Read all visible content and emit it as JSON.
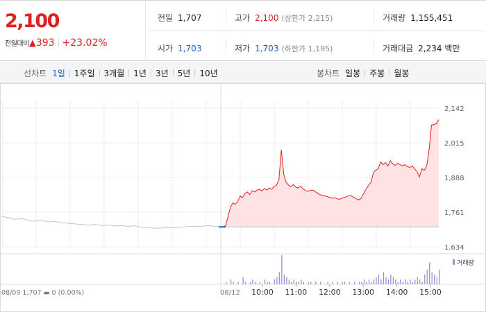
{
  "quote": {
    "price": "2,100",
    "change_label": "전일대비",
    "change_arrow": "▲",
    "change_value": "393",
    "change_rate": "+23.02%"
  },
  "info": {
    "prev_close": {
      "label": "전일",
      "value": "1,707"
    },
    "high": {
      "label": "고가",
      "value": "2,100",
      "sub": "(상한가 2,215)"
    },
    "volume": {
      "label": "거래량",
      "value": "1,155,451"
    },
    "open": {
      "label": "시가",
      "value": "1,703"
    },
    "low": {
      "label": "저가",
      "value": "1,703",
      "sub": "(하한가 1,195)"
    },
    "amount": {
      "label": "거래대금",
      "value": "2,234 백만"
    }
  },
  "tabs": {
    "line_title": "선차트",
    "line_periods": [
      "1일",
      "1주일",
      "3개월",
      "1년",
      "3년",
      "5년",
      "10년"
    ],
    "line_active": 0,
    "candle_title": "봉차트",
    "candle_periods": [
      "일봉",
      "주봉",
      "월봉"
    ]
  },
  "colors": {
    "up": "#e1201f",
    "down": "#1a5dd0",
    "area_fill": "#fde3e3",
    "prev_line": "#c0c4c8",
    "volume_bar": "#9b8fd6"
  },
  "chart_data": {
    "type": "area",
    "ylim": [
      1634,
      2142
    ],
    "y_ticks": [
      "2,142",
      "2,015",
      "1,888",
      "1,761",
      "1,634"
    ],
    "y_tick_values": [
      2142,
      2015,
      1888,
      1761,
      1634
    ],
    "prev_close_value": 1707,
    "prev_day": {
      "label": "08/09",
      "summary": "08/09  1,707 ▬ 0 (0.00%)",
      "values": [
        1745,
        1740,
        1735,
        1738,
        1730,
        1728,
        1732,
        1725,
        1727,
        1722,
        1720,
        1718,
        1716,
        1714,
        1716,
        1712,
        1714,
        1710,
        1712,
        1709,
        1711,
        1706,
        1704,
        1702,
        1703,
        1705,
        1704,
        1706,
        1708,
        1710,
        1708,
        1712,
        1710,
        1707
      ]
    },
    "today": {
      "label": "08/12",
      "x_ticks": [
        "10:00",
        "11:00",
        "12:00",
        "13:00",
        "14:00",
        "15:00"
      ],
      "values": [
        1707,
        1707,
        1712,
        1745,
        1780,
        1795,
        1790,
        1800,
        1820,
        1815,
        1830,
        1835,
        1825,
        1840,
        1835,
        1842,
        1845,
        1838,
        1848,
        1842,
        1850,
        1845,
        1855,
        1860,
        1880,
        1990,
        1900,
        1870,
        1860,
        1855,
        1862,
        1852,
        1850,
        1856,
        1846,
        1840,
        1838,
        1840,
        1842,
        1836,
        1830,
        1825,
        1822,
        1820,
        1818,
        1815,
        1812,
        1814,
        1810,
        1808,
        1812,
        1815,
        1818,
        1822,
        1820,
        1815,
        1810,
        1806,
        1812,
        1830,
        1845,
        1860,
        1870,
        1905,
        1915,
        1920,
        1945,
        1935,
        1942,
        1930,
        1950,
        1938,
        1932,
        1940,
        1935,
        1930,
        1935,
        1928,
        1925,
        1930,
        1920,
        1910,
        1890,
        1920,
        1915,
        1930,
        1990,
        2080,
        2082,
        2085,
        2100
      ]
    },
    "volume_label": "거래량",
    "volume": [
      0,
      0,
      1,
      0,
      2,
      1,
      0,
      1,
      0,
      3,
      1,
      0,
      1,
      2,
      1,
      0,
      1,
      0,
      2,
      1,
      1,
      0,
      2,
      3,
      5,
      12,
      4,
      3,
      2,
      1,
      2,
      1,
      1,
      2,
      1,
      0,
      1,
      1,
      0,
      1,
      0,
      1,
      0,
      0,
      1,
      0,
      1,
      0,
      1,
      0,
      1,
      1,
      0,
      1,
      0,
      1,
      0,
      1,
      1,
      2,
      1,
      2,
      1,
      2,
      3,
      4,
      2,
      5,
      3,
      2,
      4,
      3,
      2,
      1,
      2,
      1,
      2,
      1,
      2,
      1,
      2,
      3,
      2,
      1,
      4,
      6,
      9,
      5,
      4,
      3,
      6
    ]
  }
}
